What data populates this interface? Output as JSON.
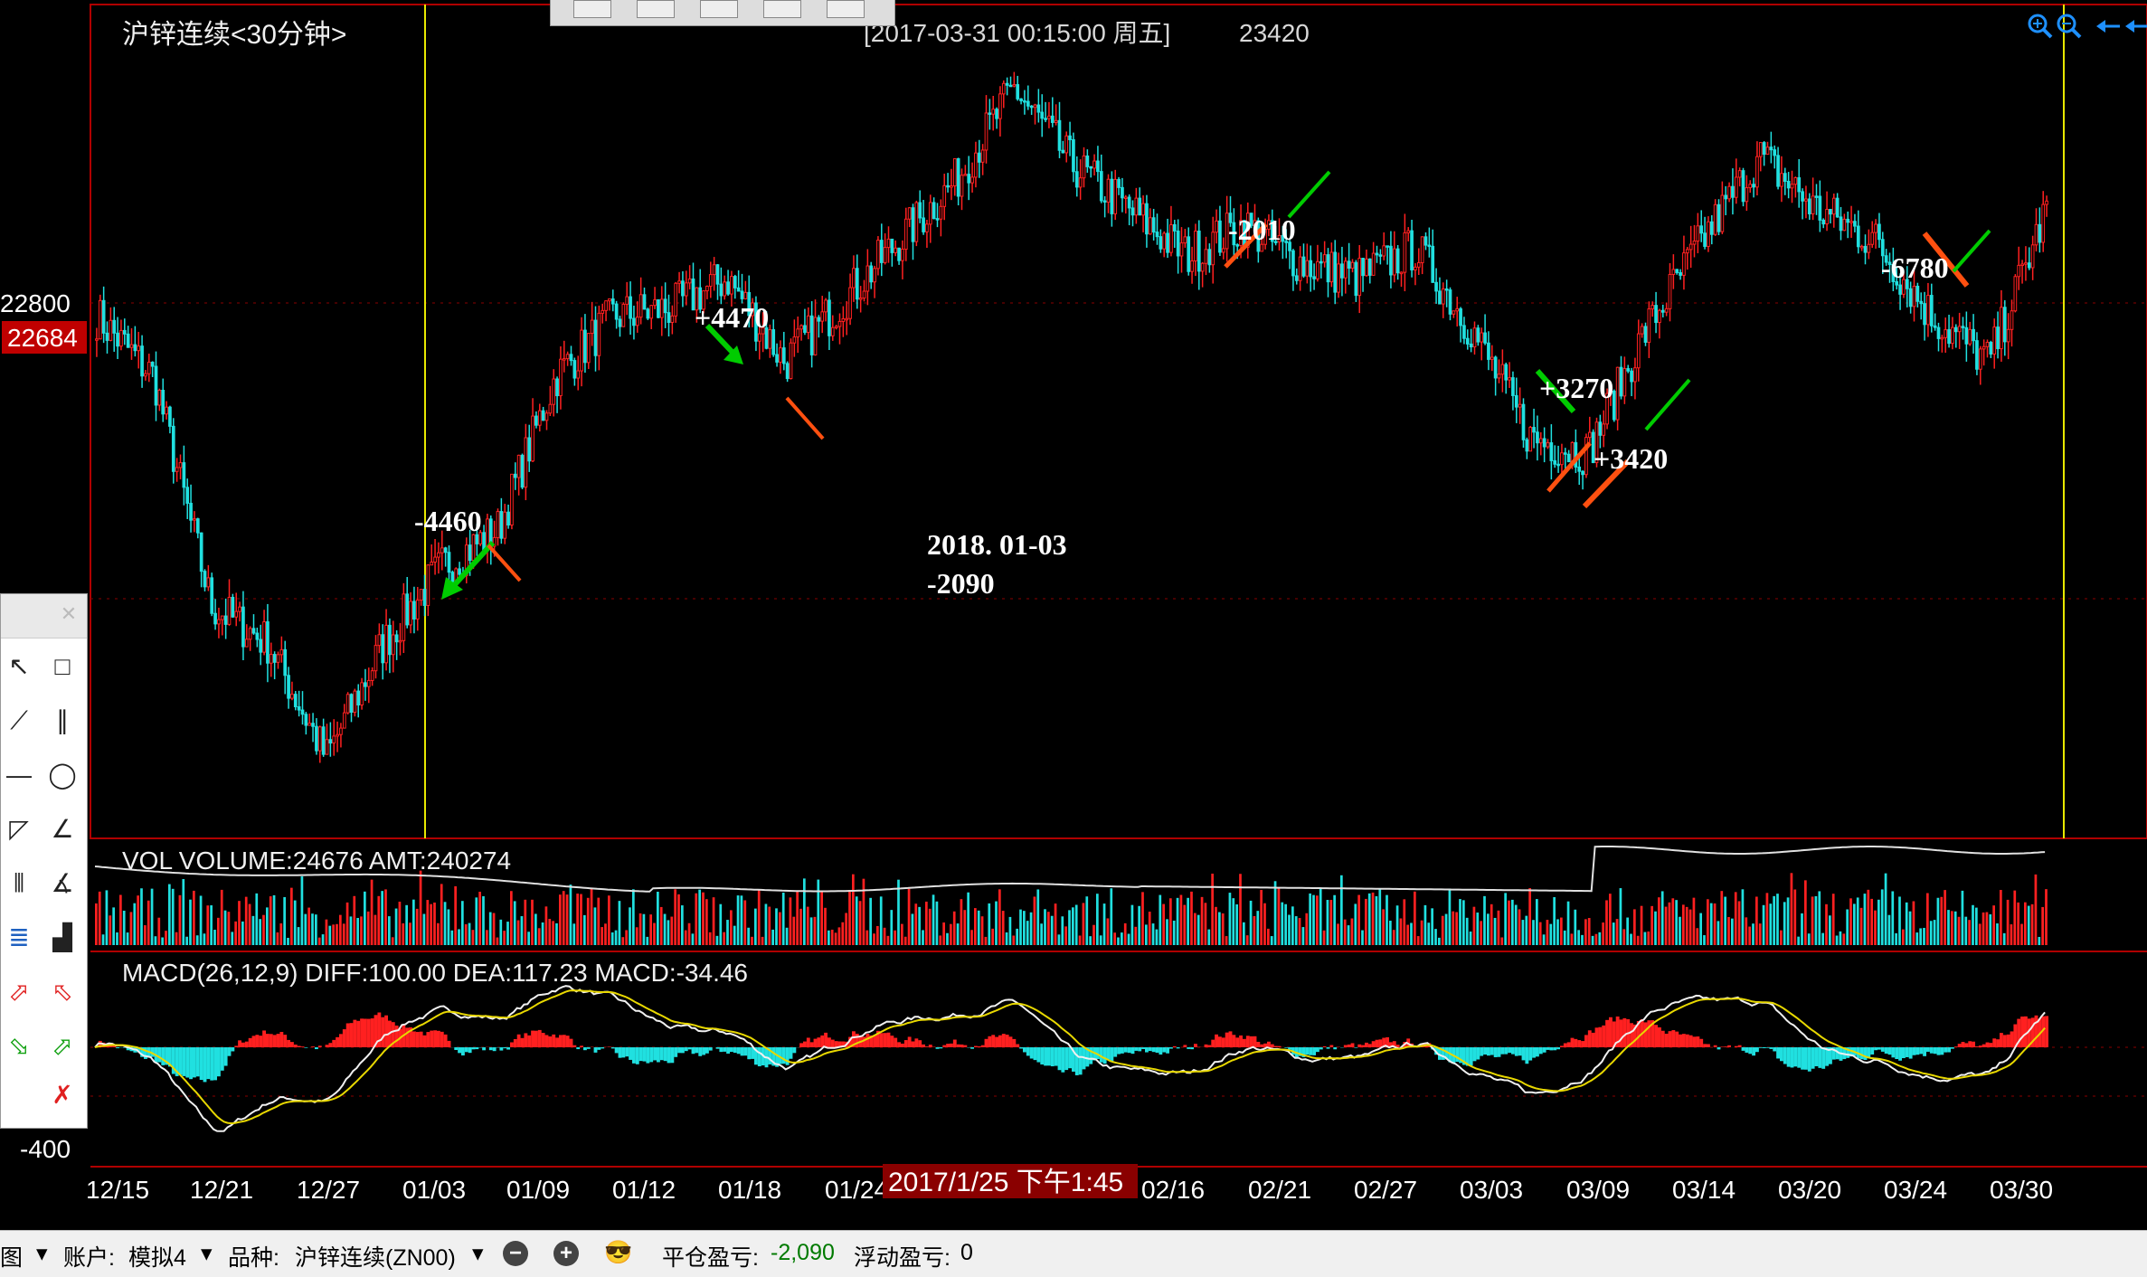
{
  "title": "沪锌连续<30分钟>",
  "header_info": "[2017-03-31  00:15:00 周五]",
  "header_value": "23420",
  "price_axis": {
    "label_high": "22800",
    "current_price": "22684"
  },
  "vol_label": "VOL  VOLUME:24676 AMT:240274",
  "macd_label": "MACD(26,12,9)  DIFF:100.00 DEA:117.23 MACD:-34.46",
  "macd_axis_label": "-400",
  "annotations": [
    {
      "text": "-4460",
      "time": "01/03"
    },
    {
      "text": "+4470",
      "time": "01/18"
    },
    {
      "text": "-2010",
      "time": "02/21"
    },
    {
      "text": "+3270",
      "time": "03/09"
    },
    {
      "text": "+3420",
      "time": "03/09"
    },
    {
      "text": "-6780",
      "time": "03/24"
    }
  ],
  "note_line1": "2018. 01-03",
  "note_line2": "-2090",
  "cursor_label": "2017/1/25 下午1:45",
  "statusbar": {
    "chart_menu": "图",
    "account_label": "账户:",
    "account_value": "模拟4",
    "symbol_label": "品种:",
    "symbol_value": "沪锌连续(ZN00)",
    "close_pl_label": "平仓盈亏:",
    "close_pl_value": "-2,090",
    "float_pl_label": "浮动盈亏:",
    "float_pl_value": "0"
  },
  "colors": {
    "up": "#ff2020",
    "down": "#20e0e0",
    "vline": "#e8e800",
    "frame": "#b00000",
    "arrow_green": "#00cc00",
    "arrow_red": "#ff5010"
  },
  "icons": [
    "zoom-in-icon",
    "zoom-out-icon",
    "arrow-left-icon",
    "arrow-left-double-icon"
  ],
  "chart_data": {
    "type": "candlestick",
    "title": "沪锌连续<30分钟>",
    "x_tick_labels": [
      "12/15",
      "12/21",
      "12/27",
      "01/03",
      "01/09",
      "01/12",
      "01/18",
      "01/24",
      "02/16",
      "02/21",
      "02/27",
      "03/03",
      "03/09",
      "03/14",
      "03/20",
      "03/24",
      "03/30"
    ],
    "close_series_approx": [
      {
        "date": "12/15",
        "close": 22780
      },
      {
        "date": "12/18",
        "close": 22700
      },
      {
        "date": "12/21",
        "close": 22400
      },
      {
        "date": "12/25",
        "close": 22350
      },
      {
        "date": "12/27",
        "close": 22200
      },
      {
        "date": "12/29",
        "close": 22350
      },
      {
        "date": "01/03",
        "close": 22450
      },
      {
        "date": "01/05",
        "close": 22500
      },
      {
        "date": "01/09",
        "close": 22700
      },
      {
        "date": "01/11",
        "close": 22780
      },
      {
        "date": "01/12",
        "close": 22790
      },
      {
        "date": "01/15",
        "close": 22830
      },
      {
        "date": "01/18",
        "close": 22720
      },
      {
        "date": "01/22",
        "close": 22800
      },
      {
        "date": "01/24",
        "close": 22880
      },
      {
        "date": "02/05",
        "close": 22960
      },
      {
        "date": "02/10",
        "close": 23080
      },
      {
        "date": "02/14",
        "close": 22980
      },
      {
        "date": "02/16",
        "close": 22920
      },
      {
        "date": "02/19",
        "close": 22860
      },
      {
        "date": "02/21",
        "close": 22900
      },
      {
        "date": "02/24",
        "close": 22850
      },
      {
        "date": "02/27",
        "close": 22830
      },
      {
        "date": "03/01",
        "close": 22870
      },
      {
        "date": "03/03",
        "close": 22760
      },
      {
        "date": "03/07",
        "close": 22620
      },
      {
        "date": "03/09",
        "close": 22600
      },
      {
        "date": "03/12",
        "close": 22760
      },
      {
        "date": "03/14",
        "close": 22880
      },
      {
        "date": "03/17",
        "close": 22990
      },
      {
        "date": "03/20",
        "close": 22920
      },
      {
        "date": "03/22",
        "close": 22880
      },
      {
        "date": "03/24",
        "close": 22780
      },
      {
        "date": "03/27",
        "close": 22720
      },
      {
        "date": "03/30",
        "close": 22920
      }
    ],
    "ylim": [
      22150,
      23100
    ],
    "y_tick_labels": [
      "22800",
      "-400"
    ],
    "current_price": 22684,
    "header_value": 23420,
    "volume_last": 24676,
    "amount_last": 240274,
    "macd": {
      "params": "26,12,9",
      "diff": 100.0,
      "dea": 117.23,
      "macd": -34.46
    },
    "trade_markers": [
      {
        "label": "-4460",
        "date": "01/03"
      },
      {
        "label": "+4470",
        "date": "01/18"
      },
      {
        "label": "-2010",
        "date": "02/21"
      },
      {
        "label": "+3270",
        "date": "03/09"
      },
      {
        "label": "+3420",
        "date": "03/09"
      },
      {
        "label": "-6780",
        "date": "03/24"
      }
    ]
  }
}
